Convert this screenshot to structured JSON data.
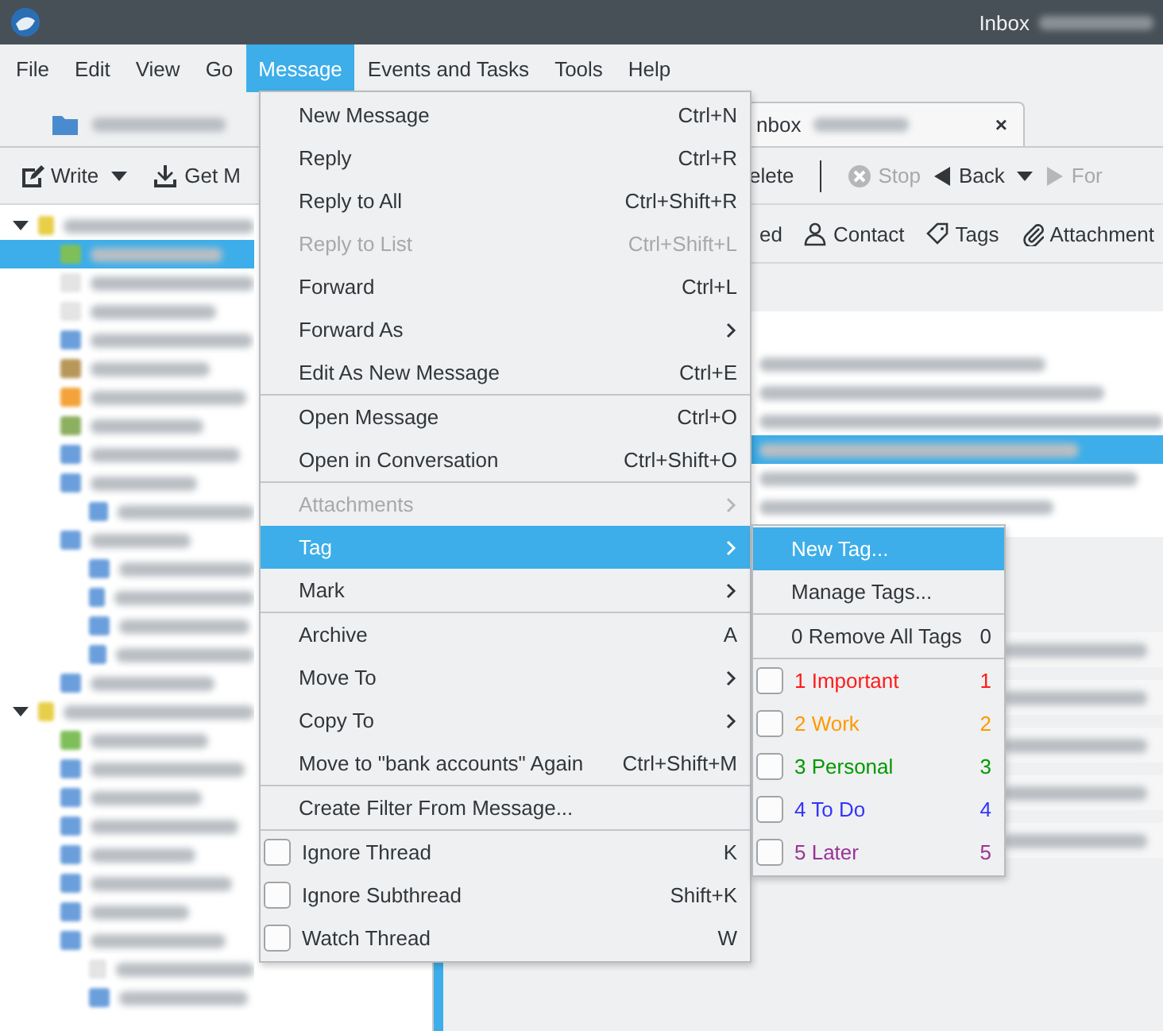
{
  "window": {
    "title": "Inbox"
  },
  "menubar": [
    {
      "label": "File",
      "selected": false
    },
    {
      "label": "Edit",
      "selected": false
    },
    {
      "label": "View",
      "selected": false
    },
    {
      "label": "Go",
      "selected": false
    },
    {
      "label": "Message",
      "selected": true
    },
    {
      "label": "Events and Tasks",
      "selected": false
    },
    {
      "label": "Tools",
      "selected": false
    },
    {
      "label": "Help",
      "selected": false
    }
  ],
  "tabs": [
    {
      "selected": false
    },
    {
      "label": "nbox",
      "close": "×",
      "selected": true
    }
  ],
  "toolbar": [
    {
      "kind": "button",
      "label": "Write",
      "disabled": false
    },
    {
      "kind": "caret"
    },
    {
      "kind": "button",
      "label": "Get M",
      "disabled": false
    },
    {
      "kind": "button",
      "label": "elete",
      "disabled": false
    },
    {
      "kind": "separator"
    },
    {
      "kind": "button",
      "label": "Stop",
      "disabled": true
    },
    {
      "kind": "button",
      "label": "Back",
      "disabled": false
    },
    {
      "kind": "caret"
    },
    {
      "kind": "button",
      "label": "For",
      "disabled": true
    }
  ],
  "quick_filter": [
    {
      "label": "ed"
    },
    {
      "label": "Contact"
    },
    {
      "label": "Tags"
    },
    {
      "label": "Attachment"
    }
  ],
  "folder_tree": [
    {
      "kind": "account",
      "selected": false
    },
    {
      "kind": "inbox",
      "selected": true
    },
    {
      "kind": "plain",
      "selected": false
    },
    {
      "kind": "plain",
      "selected": false
    },
    {
      "kind": "folder",
      "selected": false
    },
    {
      "kind": "archive",
      "selected": false
    },
    {
      "kind": "junk",
      "selected": false
    },
    {
      "kind": "trash",
      "selected": false
    },
    {
      "kind": "folder",
      "selected": false
    },
    {
      "kind": "folder",
      "selected": false
    },
    {
      "kind": "subfolder",
      "selected": false
    },
    {
      "kind": "folder",
      "selected": false
    },
    {
      "kind": "subfolder",
      "selected": false
    },
    {
      "kind": "subfolder",
      "selected": false
    },
    {
      "kind": "subfolder",
      "selected": false
    },
    {
      "kind": "subfolder",
      "selected": false
    },
    {
      "kind": "folder",
      "selected": false
    },
    {
      "kind": "account",
      "selected": false
    },
    {
      "kind": "inbox",
      "selected": false
    },
    {
      "kind": "folder",
      "selected": false
    },
    {
      "kind": "folder",
      "selected": false
    },
    {
      "kind": "folder",
      "selected": false
    },
    {
      "kind": "folder",
      "selected": false
    },
    {
      "kind": "folder",
      "selected": false
    },
    {
      "kind": "folder",
      "selected": false
    },
    {
      "kind": "folder",
      "selected": false
    },
    {
      "kind": "subplain",
      "selected": false
    },
    {
      "kind": "subfolder",
      "selected": false
    }
  ],
  "message_list": [
    {
      "selected": false
    },
    {
      "selected": false
    },
    {
      "selected": false
    },
    {
      "selected": true
    },
    {
      "selected": false
    },
    {
      "selected": false
    }
  ],
  "menu": [
    {
      "kind": "item",
      "label": "New Message",
      "shortcut": "Ctrl+N",
      "disabled": false,
      "submenu": false,
      "selected": false
    },
    {
      "kind": "item",
      "label": "Reply",
      "shortcut": "Ctrl+R",
      "disabled": false,
      "submenu": false,
      "selected": false
    },
    {
      "kind": "item",
      "label": "Reply to All",
      "shortcut": "Ctrl+Shift+R",
      "disabled": false,
      "submenu": false,
      "selected": false
    },
    {
      "kind": "item",
      "label": "Reply to List",
      "shortcut": "Ctrl+Shift+L",
      "disabled": true,
      "submenu": false,
      "selected": false
    },
    {
      "kind": "item",
      "label": "Forward",
      "shortcut": "Ctrl+L",
      "disabled": false,
      "submenu": false,
      "selected": false
    },
    {
      "kind": "item",
      "label": "Forward As",
      "disabled": false,
      "submenu": true,
      "selected": false
    },
    {
      "kind": "item",
      "label": "Edit As New Message",
      "shortcut": "Ctrl+E",
      "disabled": false,
      "submenu": false,
      "selected": false
    },
    {
      "kind": "separator"
    },
    {
      "kind": "item",
      "label": "Open Message",
      "shortcut": "Ctrl+O",
      "disabled": false,
      "submenu": false,
      "selected": false
    },
    {
      "kind": "item",
      "label": "Open in Conversation",
      "shortcut": "Ctrl+Shift+O",
      "disabled": false,
      "submenu": false,
      "selected": false
    },
    {
      "kind": "separator"
    },
    {
      "kind": "item",
      "label": "Attachments",
      "disabled": true,
      "submenu": true,
      "selected": false
    },
    {
      "kind": "item",
      "label": "Tag",
      "disabled": false,
      "submenu": true,
      "selected": true
    },
    {
      "kind": "item",
      "label": "Mark",
      "disabled": false,
      "submenu": true,
      "selected": false
    },
    {
      "kind": "separator"
    },
    {
      "kind": "item",
      "label": "Archive",
      "shortcut": "A",
      "disabled": false,
      "submenu": false,
      "selected": false
    },
    {
      "kind": "item",
      "label": "Move To",
      "disabled": false,
      "submenu": true,
      "selected": false
    },
    {
      "kind": "item",
      "label": "Copy To",
      "disabled": false,
      "submenu": true,
      "selected": false
    },
    {
      "kind": "item",
      "label": "Move to \"bank accounts\" Again",
      "shortcut": "Ctrl+Shift+M",
      "disabled": false,
      "submenu": false,
      "selected": false
    },
    {
      "kind": "separator"
    },
    {
      "kind": "item",
      "label": "Create Filter From Message...",
      "disabled": false,
      "submenu": false,
      "selected": false
    },
    {
      "kind": "separator"
    },
    {
      "kind": "check",
      "label": "Ignore Thread",
      "shortcut": "K",
      "checked": false,
      "selected": false
    },
    {
      "kind": "check",
      "label": "Ignore Subthread",
      "shortcut": "Shift+K",
      "checked": false,
      "selected": false
    },
    {
      "kind": "check",
      "label": "Watch Thread",
      "shortcut": "W",
      "checked": false,
      "selected": false
    }
  ],
  "tag_submenu": [
    {
      "kind": "item",
      "label": "New Tag...",
      "selected": true
    },
    {
      "kind": "item",
      "label": "Manage Tags...",
      "selected": false
    },
    {
      "kind": "separator"
    },
    {
      "kind": "item",
      "label": "0 Remove All Tags",
      "shortcut": "0",
      "selected": false
    },
    {
      "kind": "separator"
    },
    {
      "kind": "check",
      "label": "1 Important",
      "shortcut": "1",
      "checked": false,
      "color": "#ff1a1a",
      "selected": false
    },
    {
      "kind": "check",
      "label": "2 Work",
      "shortcut": "2",
      "checked": false,
      "color": "#ff9900",
      "selected": false
    },
    {
      "kind": "check",
      "label": "3 Personal",
      "shortcut": "3",
      "checked": false,
      "color": "#009900",
      "selected": false
    },
    {
      "kind": "check",
      "label": "4 To Do",
      "shortcut": "4",
      "checked": false,
      "color": "#3333ff",
      "selected": false
    },
    {
      "kind": "check",
      "label": "5 Later",
      "shortcut": "5",
      "checked": false,
      "color": "#993399",
      "selected": false
    }
  ]
}
